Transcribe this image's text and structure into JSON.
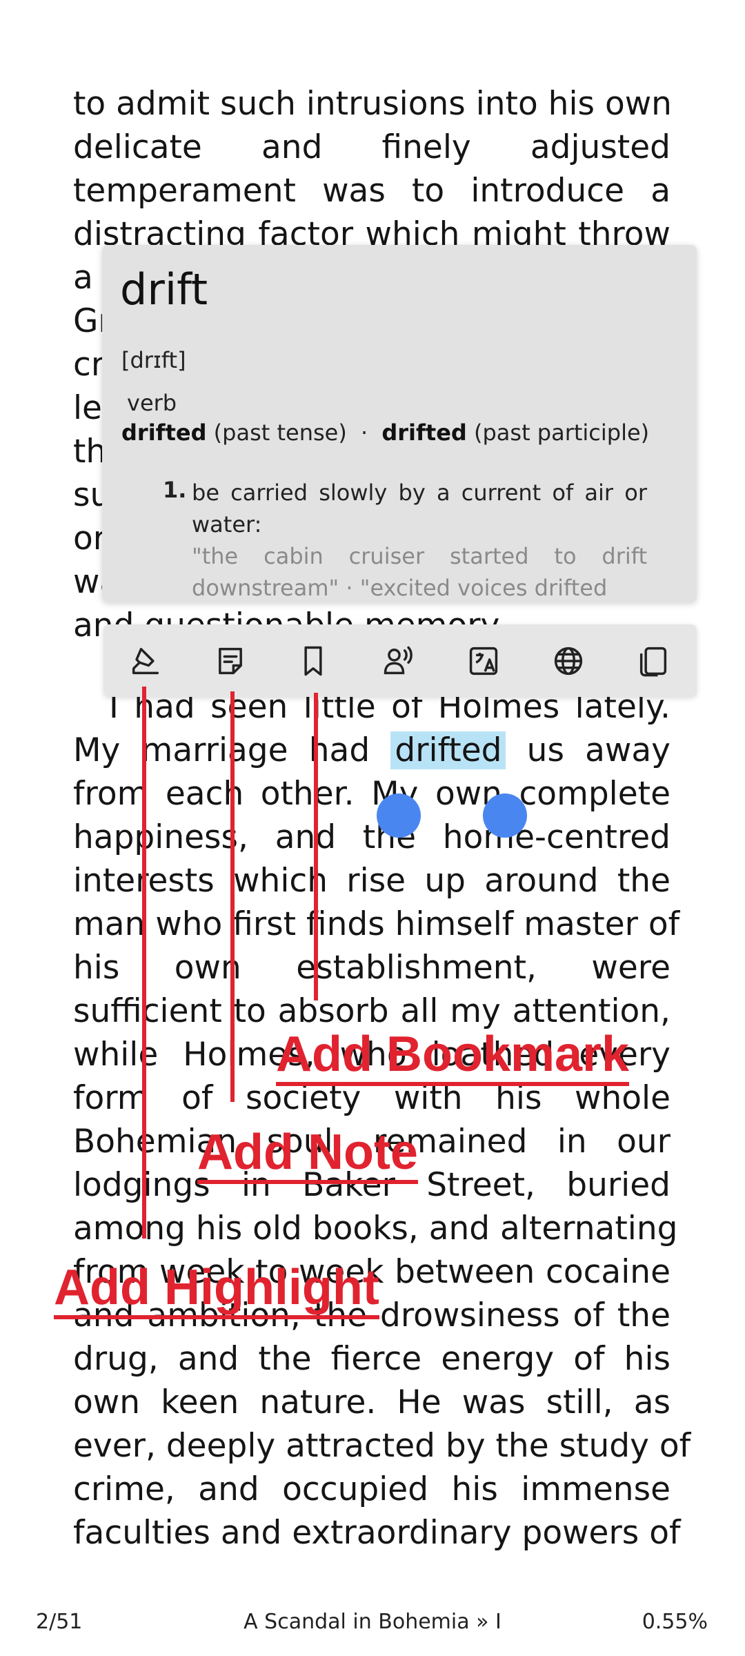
{
  "reader": {
    "lines_top": [
      "to admit such intrusions into his own",
      "delicate and finely adjusted",
      "temperament was to introduce a",
      "distracting factor which might throw",
      "a",
      "Gr",
      "cr",
      "le",
      "th",
      "su",
      "or",
      "wa",
      "and questionable memory."
    ],
    "para2": {
      "line1": "I had seen little of Holmes lately.",
      "line2_pre": "My marriage had",
      "line2_sel": "drifted",
      "line2_post": "us away",
      "lines": [
        "from each other. My own complete",
        "happiness, and the home-centred",
        "interests which rise up around the",
        "man who first finds himself master of",
        "his own establishment, were",
        "sufficient to absorb all my attention,",
        "while Holmes, who loathed every",
        "form of society with his whole",
        "Bohemian soul, remained in our",
        "lodgings in Baker Street, buried",
        "among his old books, and alternating",
        "from week to week between cocaine",
        "and ambition, the drowsiness of the",
        "drug, and the fierce energy of his",
        "own keen nature. He was still, as",
        "ever, deeply attracted by the study of",
        "crime, and occupied his immense",
        "faculties and extraordinary powers of"
      ]
    }
  },
  "dictionary": {
    "word": "drift",
    "pronunciation": "[drɪft]",
    "part_of_speech": "verb",
    "form1": "drifted",
    "form1_label": "(past tense)",
    "separator": "·",
    "form2": "drifted",
    "form2_label": "(past participle)",
    "sense_number": "1.",
    "definition": "be carried slowly by a current of air or water:",
    "examples": "\"the cabin cruiser started to drift downstream\" · \"excited voices drifted"
  },
  "toolbar": {
    "buttons": [
      "highlight-icon",
      "note-icon",
      "bookmark-icon",
      "read-aloud-icon",
      "translate-image-icon",
      "web-search-icon",
      "copy-icon"
    ]
  },
  "annotations": {
    "bookmark": "Add Bookmark",
    "note": "Add Note",
    "highlight": "Add Highlight",
    "color": "#e0232f"
  },
  "footer": {
    "page": "2/51",
    "title": "A Scandal in Bohemia » I",
    "progress": "0.55%"
  },
  "colors": {
    "selection": "#b8e3f6",
    "handle": "#4a86f0",
    "popup_bg": "#e2e2e2"
  }
}
